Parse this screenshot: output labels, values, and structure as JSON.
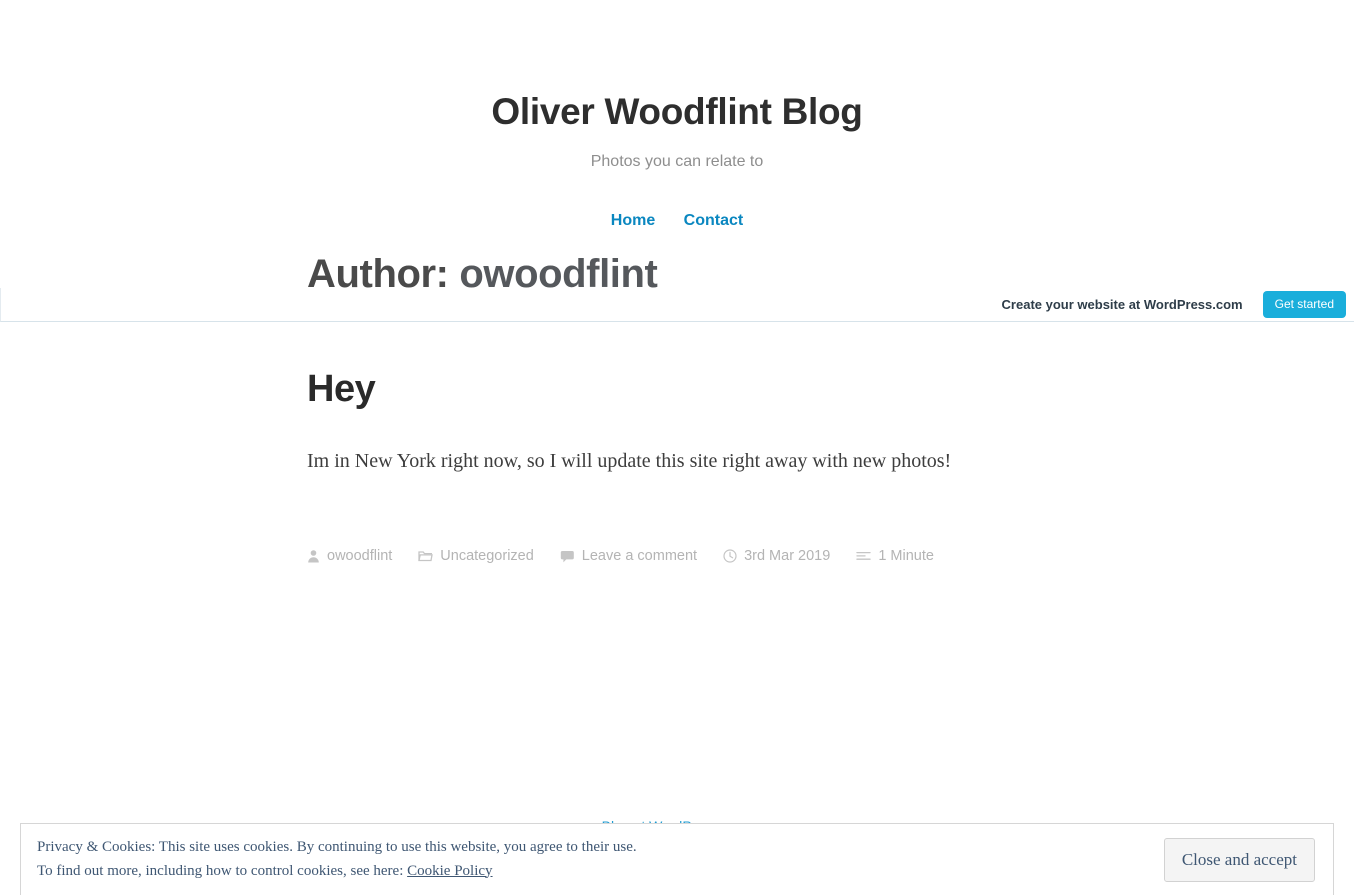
{
  "site": {
    "title": "Oliver Woodflint Blog",
    "tagline": "Photos you can relate to",
    "nav": [
      {
        "label": "Home",
        "name": "nav-link-home"
      },
      {
        "label": "Contact",
        "name": "nav-link-contact"
      }
    ]
  },
  "promo_banner": {
    "text": "Create your website at WordPress.com",
    "button_label": "Get started",
    "accent_color": "#1aaedb"
  },
  "page": {
    "title_prefix": "Author:",
    "title_name": "owoodflint",
    "title_full": "Author: owoodflint"
  },
  "post": {
    "title": "Hey",
    "body": "Im in New York right now, so I will update this site right away with new photos!",
    "meta": {
      "author": "owoodflint",
      "category": "Uncategorized",
      "comments": "Leave a comment",
      "date": "3rd Mar 2019",
      "reading_time": "1 Minute"
    }
  },
  "footer": {
    "credit": "Blog at WordPress.com."
  },
  "cookie_banner": {
    "line1": "Privacy & Cookies: This site uses cookies. By continuing to use this website, you agree to their use.",
    "line2_prefix": "To find out more, including how to control cookies, see here:",
    "policy_link": "Cookie Policy",
    "accept_label": "Close and accept"
  }
}
